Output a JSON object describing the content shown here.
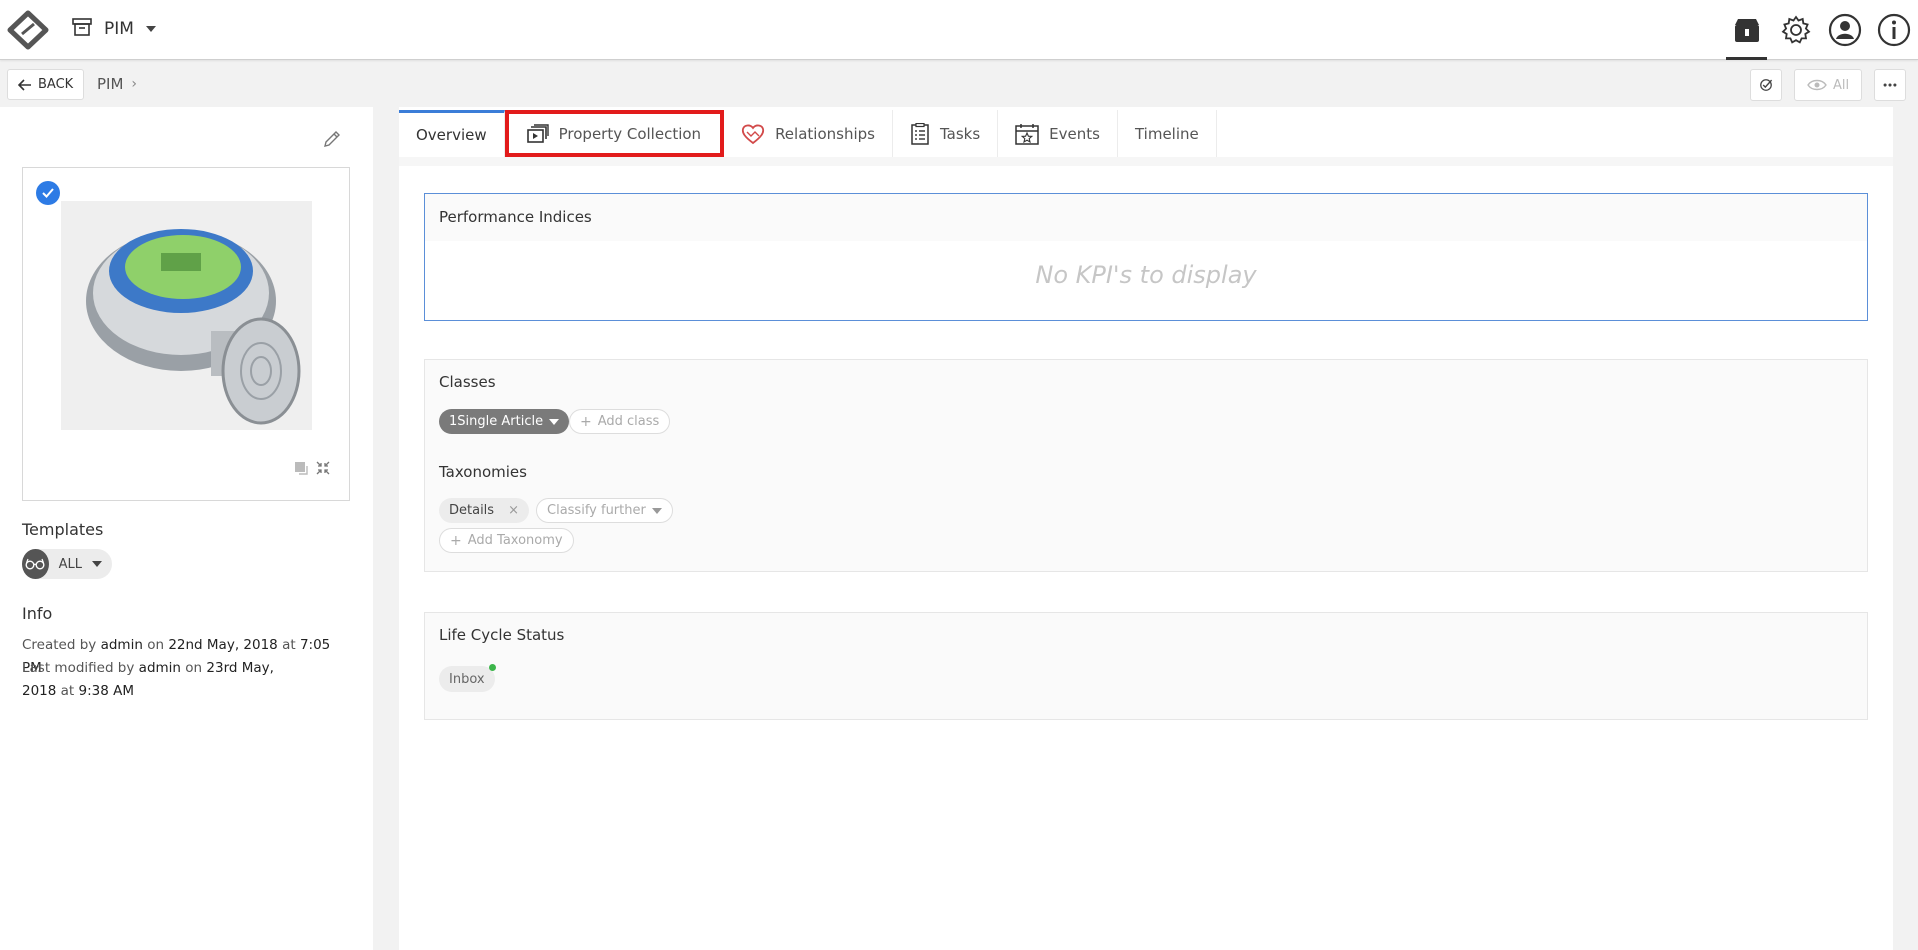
{
  "header": {
    "app_switcher": {
      "label": "PIM"
    },
    "icons": [
      "package-icon",
      "gear-icon",
      "user-icon",
      "info-icon"
    ]
  },
  "breadcrumb": {
    "back_label": "BACK",
    "path": [
      "PIM"
    ],
    "separator": "›",
    "view_filter_label": "All"
  },
  "left_panel": {
    "templates_heading": "Templates",
    "template_chip_label": "ALL",
    "info_heading": "Info",
    "created": {
      "prefix": "Created by",
      "user": "admin",
      "on": "on",
      "date": "22nd May, 2018",
      "at": "at",
      "time": "7:05 PM"
    },
    "modified": {
      "prefix": "Last modified by",
      "user": "admin",
      "on": "on",
      "date_part1": "23rd May,",
      "date_part2": "2018",
      "at": "at",
      "time": "9:38 AM"
    }
  },
  "tabs": [
    {
      "label": "Overview",
      "active": true
    },
    {
      "label": "Property Collection",
      "highlighted": true
    },
    {
      "label": "Relationships"
    },
    {
      "label": "Tasks"
    },
    {
      "label": "Events"
    },
    {
      "label": "Timeline"
    }
  ],
  "performance": {
    "title": "Performance Indices",
    "empty_text": "No KPI's to display"
  },
  "classes": {
    "title": "Classes",
    "class_chip": "1Single Article",
    "add_class": "Add class"
  },
  "taxonomies": {
    "title": "Taxonomies",
    "chip": "Details",
    "classify_further": "Classify further",
    "add_taxonomy": "Add Taxonomy"
  },
  "lifecycle": {
    "title": "Life Cycle Status",
    "status": "Inbox"
  },
  "colors": {
    "accent": "#3b7dd8",
    "highlight": "#e21b1b",
    "status_ok": "#3cb54a"
  }
}
